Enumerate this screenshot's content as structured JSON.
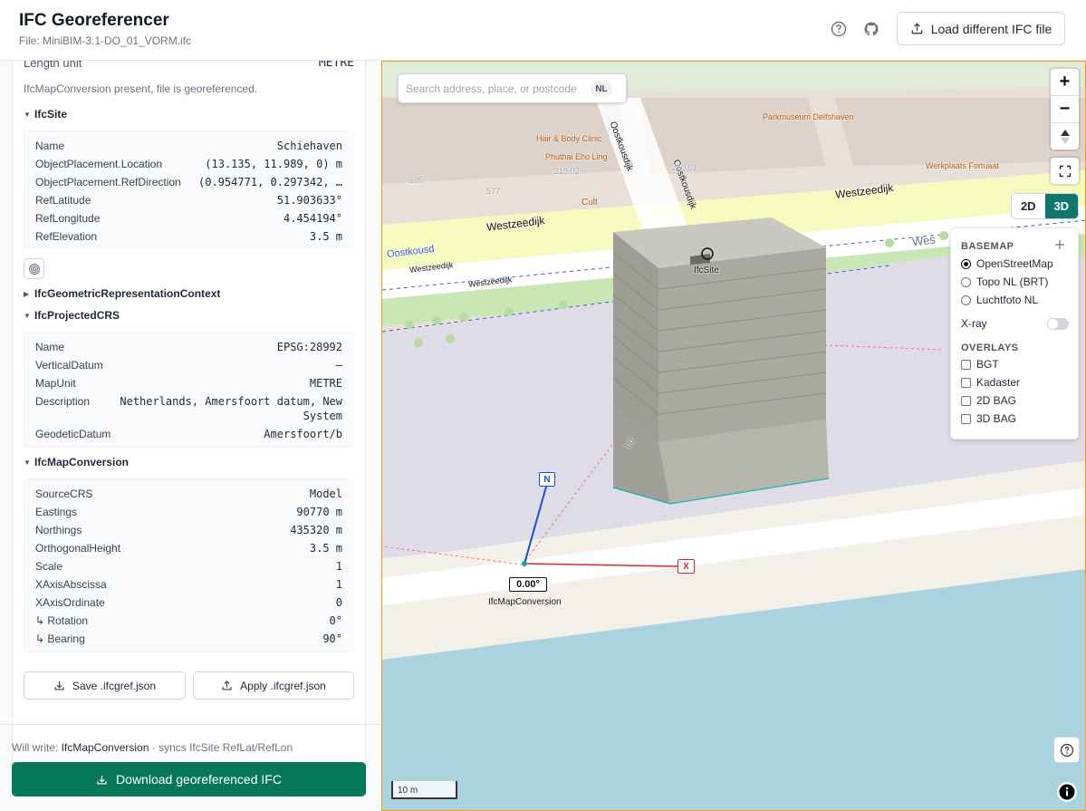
{
  "header": {
    "title": "IFC Georeferencer",
    "file_label": "File: MiniBIM-3.1-DO_01_VORM.ifc",
    "load_button": "Load different IFC file"
  },
  "panel": {
    "length_unit": {
      "key": "Length unit",
      "value": "METRE"
    },
    "georef_note": "IfcMapConversion present, file is georeferenced.",
    "sections": {
      "ifcsite": {
        "title": "IfcSite",
        "rows": [
          {
            "k": "Name",
            "v": "Schiehaven"
          },
          {
            "k": "ObjectPlacement.Location",
            "v": "(13.135, 11.989, 0) m"
          },
          {
            "k": "ObjectPlacement.RefDirection",
            "v": "(0.954771, 0.297342, …"
          },
          {
            "k": "RefLatitude",
            "v": "51.903633°"
          },
          {
            "k": "RefLongitude",
            "v": "4.454194°"
          },
          {
            "k": "RefElevation",
            "v": "3.5 m"
          }
        ]
      },
      "geomcontext": {
        "title": "IfcGeometricRepresentationContext"
      },
      "projcrs": {
        "title": "IfcProjectedCRS",
        "rows": [
          {
            "k": "Name",
            "v": "EPSG:28992"
          },
          {
            "k": "VerticalDatum",
            "v": "—"
          },
          {
            "k": "MapUnit",
            "v": "METRE"
          },
          {
            "k": "Description",
            "v": "Netherlands, Amersfoort datum, New",
            "v2": "System"
          },
          {
            "k": "GeodeticDatum",
            "v": "Amersfoort/b"
          }
        ]
      },
      "mapconv": {
        "title": "IfcMapConversion",
        "rows": [
          {
            "k": "SourceCRS",
            "v": "Model"
          },
          {
            "k": "Eastings",
            "v": "90770 m"
          },
          {
            "k": "Northings",
            "v": "435320 m"
          },
          {
            "k": "OrthogonalHeight",
            "v": "3.5 m"
          },
          {
            "k": "Scale",
            "v": "1"
          },
          {
            "k": "XAxisAbscissa",
            "v": "1"
          },
          {
            "k": "XAxisOrdinate",
            "v": "0"
          },
          {
            "k": "↳ Rotation",
            "v": "0°"
          },
          {
            "k": "↳ Bearing",
            "v": "90°"
          }
        ]
      }
    },
    "save_button": "Save .ifcgref.json",
    "apply_button": "Apply .ifcgref.json",
    "will_write_prefix": "Will write:",
    "will_write_target": "IfcMapConversion",
    "will_write_suffix": "· syncs IfcSite RefLat/RefLon",
    "download_button": "Download georeferenced IFC"
  },
  "map": {
    "search_placeholder": "Search address, place, or postcode",
    "search_chip": "NL",
    "zoom_in": "+",
    "zoom_out": "−",
    "mode_2d": "2D",
    "mode_3d": "3D",
    "mode_active": "3D",
    "layers": {
      "basemap_title": "BASEMAP",
      "basemaps": [
        "OpenStreetMap",
        "Topo NL (BRT)",
        "Luchtfoto NL"
      ],
      "basemap_selected": "OpenStreetMap",
      "xray_label": "X-ray",
      "xray_on": false,
      "overlays_title": "OVERLAYS",
      "overlays": [
        "BGT",
        "Kadaster",
        "2D BAG",
        "3D BAG"
      ]
    },
    "labels": {
      "ifcsite": "IfcSite",
      "mapconversion": "IfcMapConversion",
      "angle": "0.00°",
      "north": "N",
      "x_axis": "X",
      "scale": "10 m",
      "street_westzeedijk": "Westzeedijk",
      "street_westzeedijk_2": "Westzeedijk",
      "street_westzeedijk_3": "Wes",
      "street_oostkousdijk": "Oostkousdijk",
      "street_oostkousdijk_2": "Oostkousdijk",
      "street_oostkous": "Oostkousd",
      "street_westzeedijk_small": "Westzeedijk",
      "street_westzeedijk_small_2": "Westzeedijk",
      "poi_parkmuseum": "Parkmuseum Delfshaven",
      "poi_beauty": "Hair & Body Clinic",
      "poi_phuthai": "Phuthai Eho Ling",
      "poi_werkplaats": "Werkplaats Fortuaat",
      "poi_cult": "Cult",
      "hn_595": "595",
      "hn_577": "577",
      "hn_218": "218.02",
      "hn_210": "210.01",
      "street_lo": "Lo"
    },
    "colors": {
      "accent": "#047857",
      "water": "#aad3df",
      "land": "#e8e0d8",
      "road_main": "#f7fabf",
      "building": "#a8a79f",
      "plaza": "#dedde7",
      "north_axis": "#1d4ed8",
      "x_axis": "#dc2626"
    }
  }
}
